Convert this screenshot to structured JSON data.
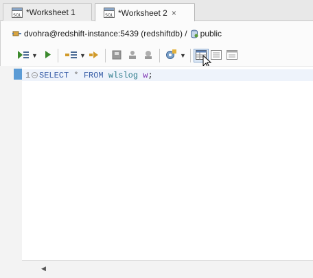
{
  "tabs": [
    {
      "label": "*Worksheet 1",
      "active": false
    },
    {
      "label": "*Worksheet 2",
      "active": true,
      "close": "×"
    }
  ],
  "connection": {
    "label": "dvohra@redshift-instance:5439 (redshiftdb) /",
    "schema": "public"
  },
  "toolbar": {
    "buttons": [
      "run-script-icon",
      "run-statement-icon",
      "explain-plan-icon",
      "autotrace-icon",
      "commit-icon",
      "rollback-icon",
      "cancel-icon",
      "sql-tuning-icon",
      "grid-view-icon",
      "text-view-icon",
      "html-view-icon"
    ]
  },
  "editor": {
    "line_number": "1",
    "fold_marker": "−",
    "code": {
      "select": "SELECT",
      "star": "*",
      "from": "FROM",
      "table": "wlslog",
      "alias": "w",
      "terminator": ";"
    }
  },
  "colors": {
    "keyword": "#3a5fa8",
    "identifier": "#2b7a8a",
    "alias": "#7a2bb0",
    "run_green": "#3c8a2e",
    "marker_blue": "#5b9bd5"
  }
}
